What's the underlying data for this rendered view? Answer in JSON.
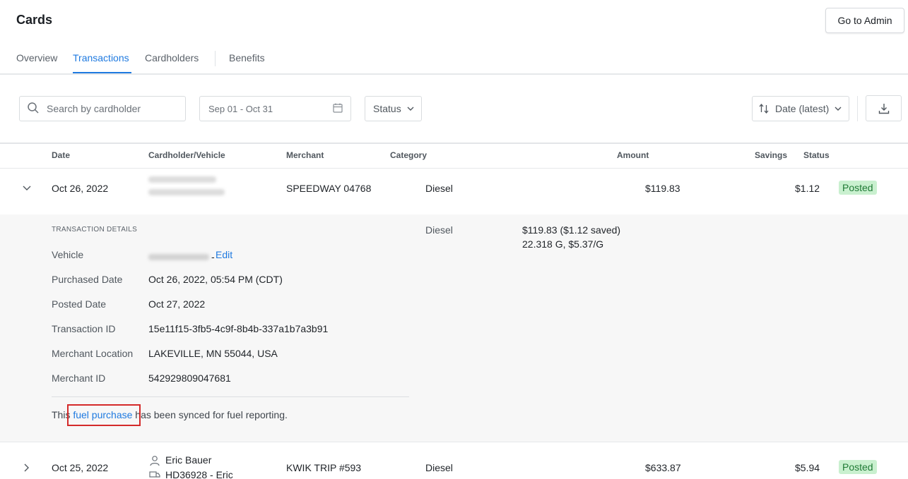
{
  "header": {
    "title": "Cards",
    "admin_button": "Go to Admin"
  },
  "tabs": [
    {
      "label": "Overview",
      "active": false
    },
    {
      "label": "Transactions",
      "active": true
    },
    {
      "label": "Cardholders",
      "active": false
    },
    {
      "label": "Benefits",
      "active": false
    }
  ],
  "toolbar": {
    "search_placeholder": "Search by cardholder",
    "date_range": "Sep 01 - Oct 31",
    "status_label": "Status",
    "sort_label": "Date (latest)"
  },
  "table": {
    "columns": [
      "Date",
      "Cardholder/Vehicle",
      "Merchant",
      "Category",
      "Amount",
      "Savings",
      "Status"
    ],
    "rows": [
      {
        "date": "Oct 26, 2022",
        "cardholder": "",
        "vehicle": "",
        "merchant": "SPEEDWAY 04768",
        "category": "Diesel",
        "amount": "$119.83",
        "savings": "$1.12",
        "status": "Posted",
        "expanded": true
      },
      {
        "date": "Oct 25, 2022",
        "cardholder": "Eric Bauer",
        "vehicle": "HD36928 - Eric",
        "merchant": "KWIK TRIP #593",
        "category": "Diesel",
        "amount": "$633.87",
        "savings": "$5.94",
        "status": "Posted",
        "expanded": false
      }
    ]
  },
  "details": {
    "title": "TRANSACTION DETAILS",
    "vehicle_label": "Vehicle",
    "edit_link": "Edit",
    "purchased_date_label": "Purchased Date",
    "purchased_date": "Oct 26, 2022, 05:54 PM (CDT)",
    "posted_date_label": "Posted Date",
    "posted_date": "Oct 27, 2022",
    "transaction_id_label": "Transaction ID",
    "transaction_id": "15e11f15-3fb5-4c9f-8b4b-337a1b7a3b91",
    "merchant_location_label": "Merchant Location",
    "merchant_location": "LAKEVILLE, MN 55044, USA",
    "merchant_id_label": "Merchant ID",
    "merchant_id": "542929809047681",
    "category": "Diesel",
    "amount_summary": "$119.83 ($1.12 saved)",
    "fuel_summary": "22.318 G, $5.37/G",
    "sync_prefix": "This",
    "sync_link": "fuel purchase",
    "sync_suffix": "has been synced for fuel reporting."
  },
  "colors": {
    "accent": "#1f7ae0",
    "posted_badge_bg": "#c9f0cf",
    "posted_badge_text": "#1f7a35",
    "highlight": "#d42a2a"
  }
}
